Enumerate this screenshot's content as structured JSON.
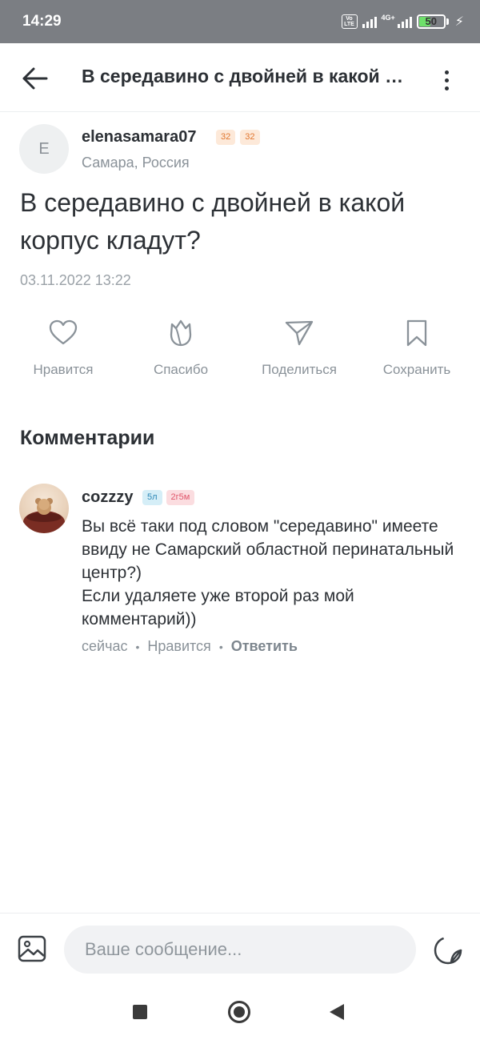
{
  "status_bar": {
    "time": "14:29",
    "volte": "Vo\nLTE",
    "network": "4G+",
    "battery_level": "50",
    "battery_percent": 50
  },
  "header": {
    "title": "В середавино с двойней в какой корпус кладут?"
  },
  "post": {
    "author_initial": "E",
    "author_name": "elenasamara07",
    "badges": [
      "32",
      "32"
    ],
    "location": "Самара, Россия",
    "question": "В середавино с двойней в какой корпус кладут?",
    "date": "03.11.2022 13:22"
  },
  "actions": [
    {
      "label": "Нравится",
      "icon": "heart-icon"
    },
    {
      "label": "Спасибо",
      "icon": "flower-icon"
    },
    {
      "label": "Поделиться",
      "icon": "send-icon"
    },
    {
      "label": "Сохранить",
      "icon": "bookmark-icon"
    }
  ],
  "comments_title": "Комментарии",
  "comment": {
    "author": "cozzzy",
    "badges": [
      "5л",
      "2г5м"
    ],
    "text": "Вы всё таки под словом \"середавино\" имеете ввиду не Самарский областной перинатальный центр?)\nЕсли удаляете уже второй раз мой комментарий))",
    "time": "сейчас",
    "like_label": "Нравится",
    "reply_label": "Ответить"
  },
  "composer": {
    "placeholder": "Ваше сообщение..."
  },
  "colors": {
    "status_bar": "#7b7e83",
    "text": "#2c3035",
    "muted": "#8a9299",
    "battery": "#6ee06a"
  }
}
